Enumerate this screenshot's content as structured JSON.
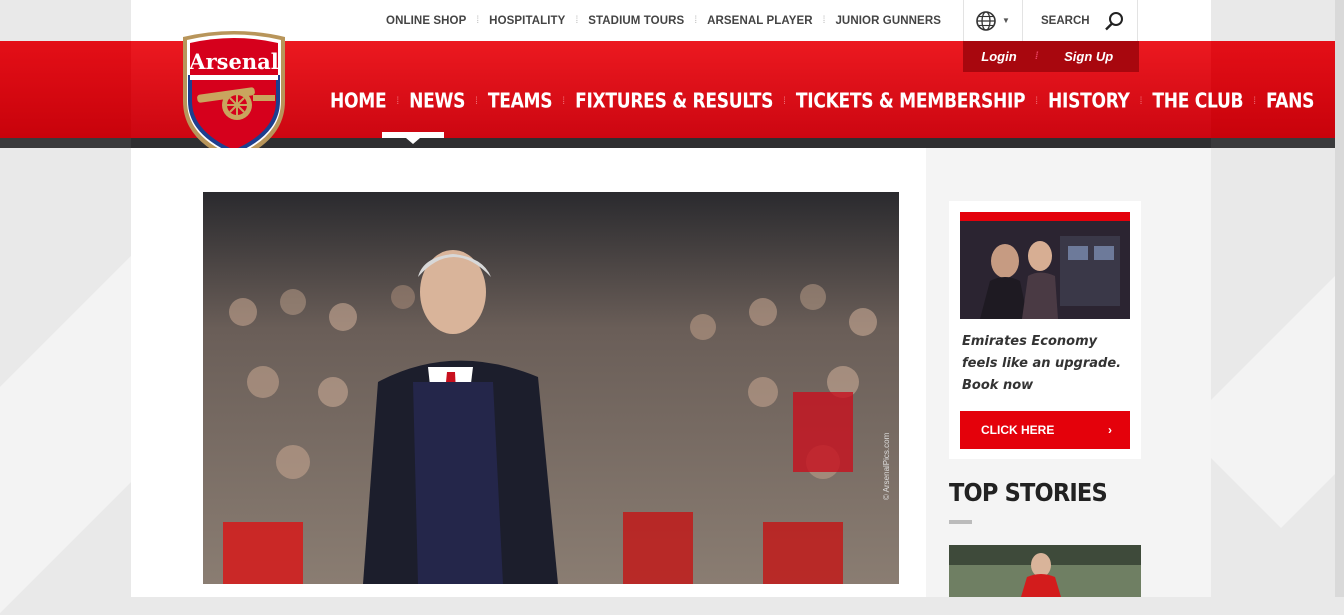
{
  "top_links": [
    "ONLINE SHOP",
    "HOSPITALITY",
    "STADIUM TOURS",
    "ARSENAL PLAYER",
    "JUNIOR GUNNERS"
  ],
  "search": {
    "label": "SEARCH",
    "icon": "search-icon"
  },
  "language": {
    "icon": "globe-icon"
  },
  "auth": {
    "login": "Login",
    "signup": "Sign Up"
  },
  "logo": {
    "text": "Arsenal"
  },
  "main_nav": [
    "HOME",
    "NEWS",
    "TEAMS",
    "FIXTURES & RESULTS",
    "TICKETS & MEMBERSHIP",
    "HISTORY",
    "THE CLUB",
    "FANS"
  ],
  "active_nav": "NEWS",
  "hero": {
    "credit": "© ArsenalPics.com"
  },
  "ad": {
    "text": "Emirates Economy feels like an upgrade. Book now",
    "cta": "CLICK HERE"
  },
  "sidebar": {
    "heading": "TOP STORIES"
  },
  "colors": {
    "brand_red": "#e4010b",
    "dark_strip": "#2f2f31"
  }
}
